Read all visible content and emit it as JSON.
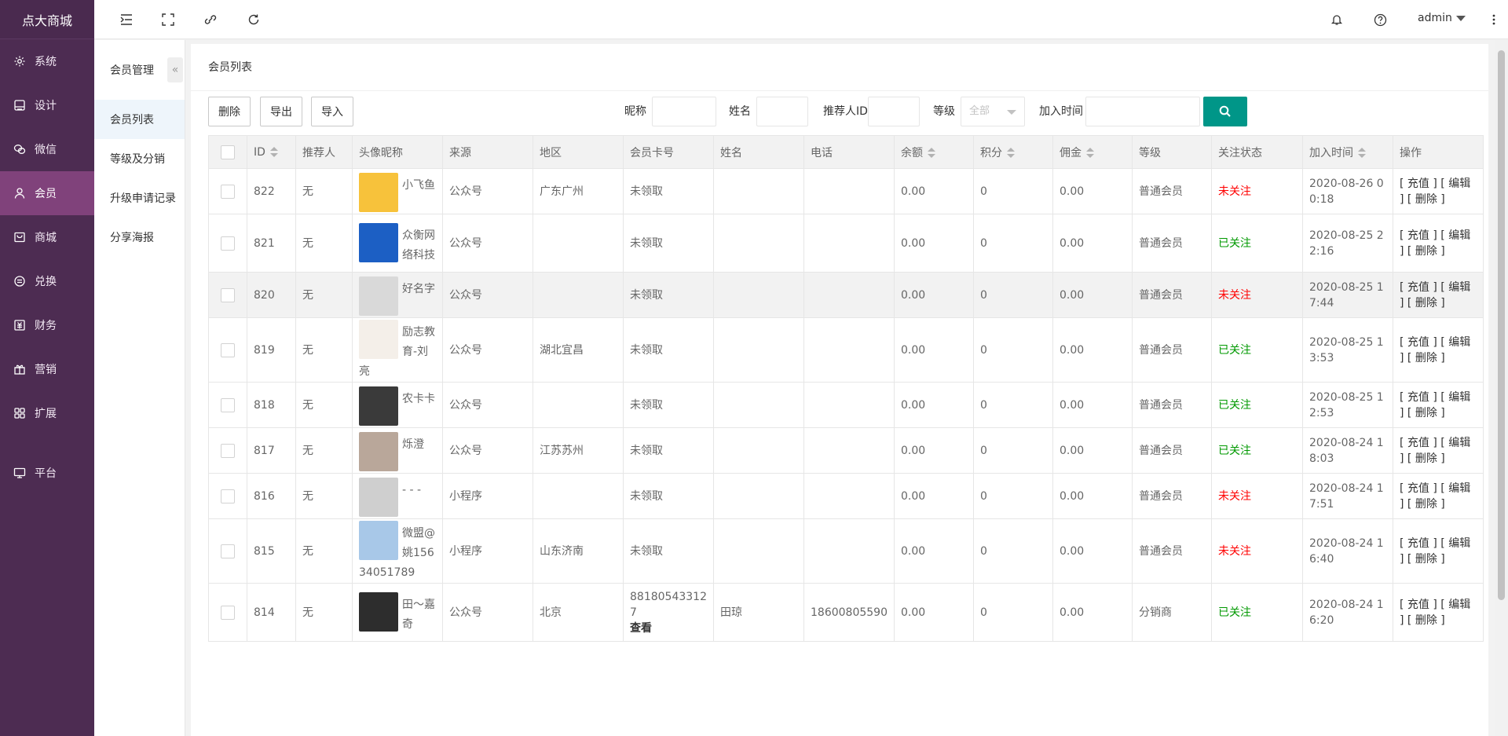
{
  "brand": "点大商城",
  "nav": [
    {
      "label": "系统",
      "icon": "gear-icon"
    },
    {
      "label": "设计",
      "icon": "design-icon"
    },
    {
      "label": "微信",
      "icon": "wechat-icon"
    },
    {
      "label": "会员",
      "icon": "user-icon"
    },
    {
      "label": "商城",
      "icon": "shop-icon"
    },
    {
      "label": "兑换",
      "icon": "exchange-icon"
    },
    {
      "label": "财务",
      "icon": "finance-icon"
    },
    {
      "label": "营销",
      "icon": "gift-icon"
    },
    {
      "label": "扩展",
      "icon": "grid-icon"
    },
    {
      "label": "平台",
      "icon": "monitor-icon"
    }
  ],
  "topbar": {
    "user": "admin"
  },
  "submenu": {
    "title": "会员管理",
    "items": [
      {
        "label": "会员列表"
      },
      {
        "label": "等级及分销"
      },
      {
        "label": "升级申请记录"
      },
      {
        "label": "分享海报"
      }
    ]
  },
  "main": {
    "title": "会员列表",
    "buttons": {
      "delete": "删除",
      "export": "导出",
      "import": "导入"
    },
    "filters": {
      "nickname": "昵称",
      "name": "姓名",
      "referrer_id": "推荐人ID",
      "level": "等级",
      "level_value": "全部",
      "join_time": "加入时间"
    }
  },
  "table": {
    "headers": {
      "id": "ID",
      "referrer": "推荐人",
      "avatar_nick": "头像昵称",
      "source": "来源",
      "region": "地区",
      "card": "会员卡号",
      "name": "姓名",
      "phone": "电话",
      "balance": "余额",
      "points": "积分",
      "commission": "佣金",
      "level": "等级",
      "follow": "关注状态",
      "join_time": "加入时间",
      "ops": "操作"
    },
    "op_labels": {
      "recharge": "[ 充值 ]",
      "edit": "[ 编辑 ]",
      "delete": "[ 删除 ]"
    },
    "rows": [
      {
        "id": "822",
        "referrer": "无",
        "nick": "小飞鱼",
        "source": "公众号",
        "region": "广东广州",
        "card": "未领取",
        "card_link": "",
        "name": "",
        "phone": "",
        "balance": "0.00",
        "points": "0",
        "commission": "0.00",
        "level": "普通会员",
        "follow": "未关注",
        "follow_color": "#ff0000",
        "join_time": "2020-08-26 00:18",
        "avatar_color": "#f7c23b"
      },
      {
        "id": "821",
        "referrer": "无",
        "nick": "众衡网络科技",
        "source": "公众号",
        "region": "",
        "card": "未领取",
        "card_link": "",
        "name": "",
        "phone": "",
        "balance": "0.00",
        "points": "0",
        "commission": "0.00",
        "level": "普通会员",
        "follow": "已关注",
        "follow_color": "#009900",
        "join_time": "2020-08-25 22:16",
        "avatar_color": "#1c5fc4"
      },
      {
        "id": "820",
        "referrer": "无",
        "nick": "好名字",
        "source": "公众号",
        "region": "",
        "card": "未领取",
        "card_link": "",
        "name": "",
        "phone": "",
        "balance": "0.00",
        "points": "0",
        "commission": "0.00",
        "level": "普通会员",
        "follow": "未关注",
        "follow_color": "#ff0000",
        "join_time": "2020-08-25 17:44",
        "avatar_color": "#d9d9d9"
      },
      {
        "id": "819",
        "referrer": "无",
        "nick": "励志教育-刘亮",
        "source": "公众号",
        "region": "湖北宜昌",
        "card": "未领取",
        "card_link": "",
        "name": "",
        "phone": "",
        "balance": "0.00",
        "points": "0",
        "commission": "0.00",
        "level": "普通会员",
        "follow": "已关注",
        "follow_color": "#009900",
        "join_time": "2020-08-25 13:53",
        "avatar_color": "#f4efe9"
      },
      {
        "id": "818",
        "referrer": "无",
        "nick": "农卡卡",
        "source": "公众号",
        "region": "",
        "card": "未领取",
        "card_link": "",
        "name": "",
        "phone": "",
        "balance": "0.00",
        "points": "0",
        "commission": "0.00",
        "level": "普通会员",
        "follow": "已关注",
        "follow_color": "#009900",
        "join_time": "2020-08-25 12:53",
        "avatar_color": "#3a3a3a"
      },
      {
        "id": "817",
        "referrer": "无",
        "nick": "烁澄",
        "source": "公众号",
        "region": "江苏苏州",
        "card": "未领取",
        "card_link": "",
        "name": "",
        "phone": "",
        "balance": "0.00",
        "points": "0",
        "commission": "0.00",
        "level": "普通会员",
        "follow": "已关注",
        "follow_color": "#009900",
        "join_time": "2020-08-24 18:03",
        "avatar_color": "#b9a79a"
      },
      {
        "id": "816",
        "referrer": "无",
        "nick": "- - -",
        "source": "小程序",
        "region": "",
        "card": "未领取",
        "card_link": "",
        "name": "",
        "phone": "",
        "balance": "0.00",
        "points": "0",
        "commission": "0.00",
        "level": "普通会员",
        "follow": "未关注",
        "follow_color": "#ff0000",
        "join_time": "2020-08-24 17:51",
        "avatar_color": "#cfcfcf"
      },
      {
        "id": "815",
        "referrer": "无",
        "nick": "微盟@姚15634051789",
        "source": "小程序",
        "region": "山东济南",
        "card": "未领取",
        "card_link": "",
        "name": "",
        "phone": "",
        "balance": "0.00",
        "points": "0",
        "commission": "0.00",
        "level": "普通会员",
        "follow": "未关注",
        "follow_color": "#ff0000",
        "join_time": "2020-08-24 16:40",
        "avatar_color": "#a8c8e8"
      },
      {
        "id": "814",
        "referrer": "无",
        "nick": "田～嘉奇",
        "source": "公众号",
        "region": "北京",
        "card": "881805433127",
        "card_link": "查看",
        "name": "田琼",
        "phone": "18600805590",
        "balance": "0.00",
        "points": "0",
        "commission": "0.00",
        "level": "分销商",
        "follow": "已关注",
        "follow_color": "#009900",
        "join_time": "2020-08-24 16:20",
        "avatar_color": "#2d2d2d"
      }
    ]
  }
}
